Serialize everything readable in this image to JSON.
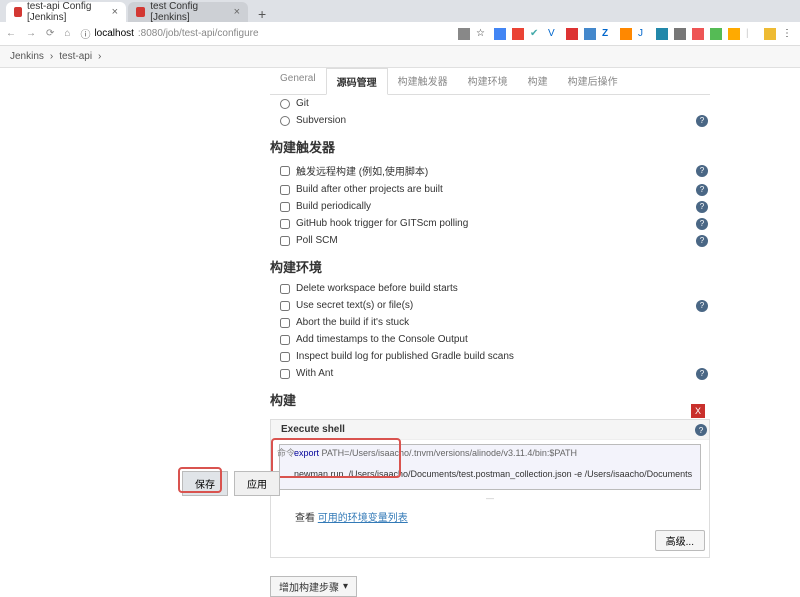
{
  "browser": {
    "tabs": [
      {
        "title": "test-api Config [Jenkins]",
        "active": true
      },
      {
        "title": "test Config [Jenkins]",
        "active": false
      }
    ],
    "url_host": "localhost",
    "url_port_path": ":8080/job/test-api/configure"
  },
  "breadcrumb": {
    "root": "Jenkins",
    "item": "test-api"
  },
  "config_tabs": {
    "items": [
      "General",
      "源码管理",
      "构建触发器",
      "构建环境",
      "构建",
      "构建后操作"
    ],
    "active_index": 1
  },
  "scm": {
    "options": [
      {
        "label": "Git",
        "help": false
      },
      {
        "label": "Subversion",
        "help": true
      }
    ]
  },
  "triggers": {
    "title": "构建触发器",
    "options": [
      {
        "label": "触发远程构建 (例如,使用脚本)",
        "help": true
      },
      {
        "label": "Build after other projects are built",
        "help": true
      },
      {
        "label": "Build periodically",
        "help": true
      },
      {
        "label": "GitHub hook trigger for GITScm polling",
        "help": true
      },
      {
        "label": "Poll SCM",
        "help": true
      }
    ]
  },
  "env": {
    "title": "构建环境",
    "options": [
      {
        "label": "Delete workspace before build starts",
        "help": false
      },
      {
        "label": "Use secret text(s) or file(s)",
        "help": true
      },
      {
        "label": "Abort the build if it's stuck",
        "help": false
      },
      {
        "label": "Add timestamps to the Console Output",
        "help": false
      },
      {
        "label": "Inspect build log for published Gradle build scans",
        "help": false
      },
      {
        "label": "With Ant",
        "help": true
      }
    ]
  },
  "build": {
    "title": "构建",
    "step_title": "Execute shell",
    "cmd_label": "命令",
    "command_line1_kw": "export",
    "command_line1_rest": " PATH=/Users/isaacho/.tnvm/versions/alinode/v3.11.4/bin:$PATH",
    "command_line2": "newman run  /Users/isaacho/Documents/test.postman_collection.json -e /Users/isaacho/Documents",
    "env_hint_prefix": "查看 ",
    "env_hint_link": "可用的环境变量列表",
    "advanced": "高级...",
    "add_step": "增加构建步骤",
    "delete_x": "X"
  },
  "buttons": {
    "save": "保存",
    "apply": "应用"
  }
}
